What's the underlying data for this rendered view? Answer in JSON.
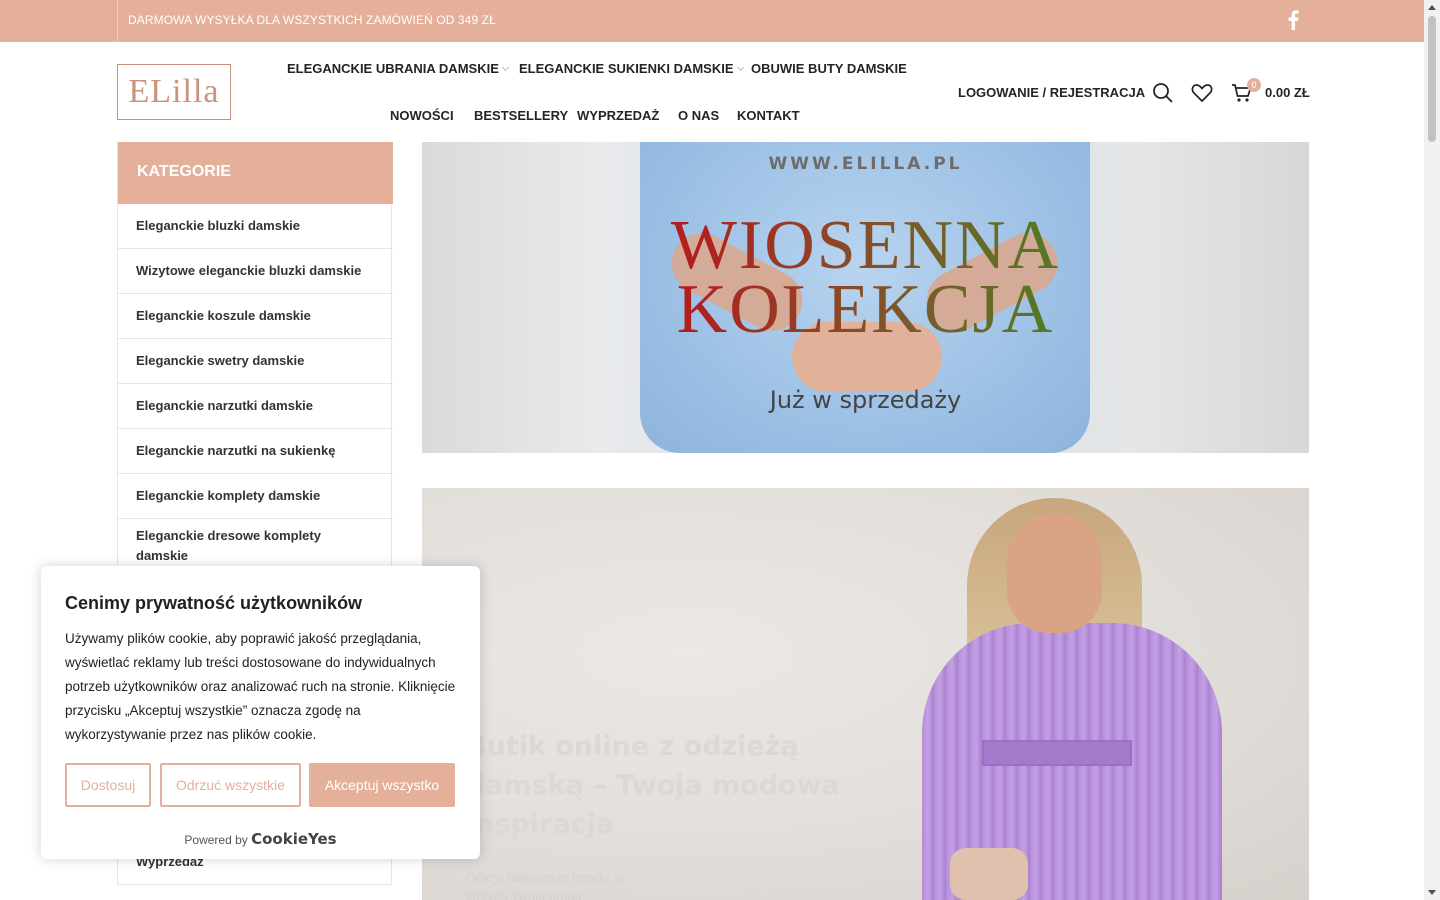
{
  "topbar": {
    "promo": "DARMOWA WYSYŁKA DLA WSZYSTKICH ZAMÓWIEŃ OD 349 ZŁ",
    "facebook_icon": "facebook-icon"
  },
  "header": {
    "logo_text": "ELilla",
    "nav_row1": [
      "ELEGANCKIE UBRANIA DAMSKIE",
      "ELEGANCKIE SUKIENKI DAMSKIE",
      "OBUWIE BUTY DAMSKIE"
    ],
    "nav_row2": [
      "NOWOŚCI",
      "BESTSELLERY",
      "WYPRZEDAŻ",
      "O NAS",
      "KONTAKT"
    ],
    "login": "LOGOWANIE / REJESTRACJA",
    "cart_count": "0",
    "cart_total": "0.00 ZŁ"
  },
  "sidebar": {
    "title": "KATEGORIE",
    "items": [
      "Eleganckie bluzki damskie",
      "Wizytowe eleganckie bluzki damskie",
      "Eleganckie koszule damskie",
      "Eleganckie swetry damskie",
      "Eleganckie narzutki damskie",
      "Eleganckie narzutki na sukienkę",
      "Eleganckie komplety damskie",
      "Eleganckie dresowe komplety damskie"
    ],
    "last_item": "Wyprzedaż"
  },
  "banner1": {
    "site": "WWW.ELILLA.PL",
    "line1": "WIOSENNA",
    "line2": "KOLEKCJA",
    "tagline": "Już w sprzedaży"
  },
  "banner2": {
    "title": "Butik online z odzieżą damską – Twoja modowa inspiracja",
    "subtitle": "Odkryj najnowsze trendy, w których Twoja uroda"
  },
  "cookie": {
    "title": "Cenimy prywatność użytkowników",
    "text": "Używamy plików cookie, aby poprawić jakość przeglądania, wyświetlać reklamy lub treści dostosowane do indywidualnych potrzeb użytkowników oraz analizować ruch na stronie. Kliknięcie przycisku „Akceptuj wszystkie” oznacza zgodę na wykorzystywanie przez nas plików cookie.",
    "btn_customize": "Dostosuj",
    "btn_reject": "Odrzuć wszystkie",
    "btn_accept": "Akceptuj wszystko",
    "powered": "Powered by",
    "brand": "CookieYes"
  },
  "colors": {
    "accent": "#e4b09a",
    "logo": "#c9937d"
  }
}
